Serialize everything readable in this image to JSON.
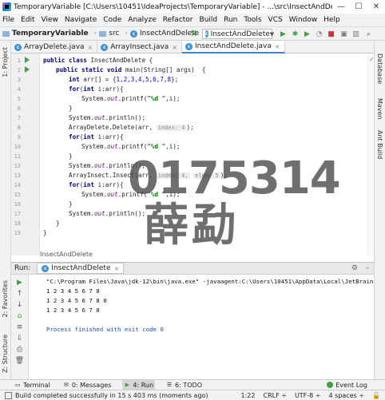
{
  "window": {
    "title": "TemporaryVariable [C:\\Users\\10451\\IdeaProjects\\TemporaryVariable] - ...\\src\\InsectAndDelete.java [T...",
    "minimize": "—",
    "maximize": "☐",
    "close": "✕"
  },
  "menu": [
    "File",
    "Edit",
    "View",
    "Navigate",
    "Code",
    "Analyze",
    "Refactor",
    "Build",
    "Run",
    "Tools",
    "VCS",
    "Window",
    "Help"
  ],
  "nav": {
    "project": "TemporaryVariable",
    "src": "src",
    "file": "InsectAndDelete",
    "run_config": "InsectAndDelete"
  },
  "left_tools": {
    "project": "1: Project",
    "favorites": "2: Favorites",
    "structure": "Z: Structure"
  },
  "right_tools": {
    "database": "Database",
    "maven": "Maven",
    "ant": "Ant Build"
  },
  "tabs": [
    {
      "label": "ArrayDelete.java",
      "active": false
    },
    {
      "label": "ArrayInsect.java",
      "active": false
    },
    {
      "label": "InsectAndDelete.java",
      "active": true
    }
  ],
  "gutter": {
    "line_numbers": [
      "1",
      "2",
      "3",
      "4",
      "5",
      "6",
      "7",
      "8",
      "9",
      "10",
      "11",
      "12",
      "13",
      "14",
      "15",
      "16",
      "17",
      "18",
      "19"
    ]
  },
  "code": {
    "l1_kw": "public class",
    "l1_name": " InsectAndDelete {",
    "l2_kw": "public static void",
    "l2_rest": " main(String[] args)  {",
    "l3_kw": "int",
    "l3_var": " arr[]",
    "l3_eq": " = {",
    "l3_nums": "1,2,3,4,5,6,7,8",
    "l3_end": "};",
    "l4_kw": "for",
    "l4_open": "(",
    "l4_kw2": "int",
    "l4_rest": " i:arr){",
    "l5_a": "System.",
    "l5_out": "out",
    "l5_b": ".printf(",
    "l5_str": "\"%d \"",
    "l5_c": ",i);",
    "l6": "}",
    "l7_a": "System.",
    "l7_out": "out",
    "l7_b": ".println();",
    "l8_a": "ArrayDelete.Delete(arr, ",
    "l8_hint": "index: 4",
    "l8_b": ");",
    "l9_kw": "for",
    "l9_open": "(",
    "l9_kw2": "int",
    "l9_rest": " i:arr){",
    "l10_a": "System.",
    "l10_out": "out",
    "l10_b": ".printf(",
    "l10_str": "\"%d \"",
    "l10_c": ",i);",
    "l11": "}",
    "l12_a": "System.",
    "l12_out": "out",
    "l12_b": ".println();",
    "l13_a": "ArrayInsect.Insect(arr, ",
    "l13_hint1": "index: 4,",
    "l13_hint2": "elem: 5",
    "l13_b": ");",
    "l14_kw": "for",
    "l14_open": "(",
    "l14_kw2": "int",
    "l14_rest": " i:arr){",
    "l15_a": "System.",
    "l15_out": "out",
    "l15_b": ".printf(",
    "l15_str": "\"%d \"",
    "l15_c": ",i);",
    "l16": "}",
    "l17_a": "System.",
    "l17_out": "out",
    "l17_b": ".println();",
    "l18": "}",
    "l19": "}"
  },
  "editor_breadcrumb": "InsectAndDelete",
  "run_panel": {
    "label": "Run:",
    "tab": "InsectAndDelete",
    "console": [
      "\"C:\\Program Files\\Java\\jdk-12\\bin\\java.exe\" -javaagent:C:\\Users\\10451\\AppData\\Local\\JetBrains\\Toolbox\\",
      "1 2 3 4 5 6 7 8",
      "1 2 3 4 5 6 7 8 0",
      "1 2 3 4 5 6 7 8",
      "",
      "Process finished with exit code 0"
    ]
  },
  "bottom_tools": [
    {
      "label": "Terminal",
      "active": false
    },
    {
      "label": "0: Messages",
      "active": false
    },
    {
      "label": "4: Run",
      "active": true
    },
    {
      "label": "6: TODO",
      "active": false
    }
  ],
  "event_log": "Event Log",
  "status": {
    "message": "Build completed successfully in 15 s 403 ms (moments ago)",
    "position": "1:22",
    "line_sep": "CRLF ÷",
    "encoding": "UTF-8 ÷",
    "indent": "4 spaces ÷"
  },
  "watermark": {
    "number": "0175314",
    "name": "薛勐"
  }
}
